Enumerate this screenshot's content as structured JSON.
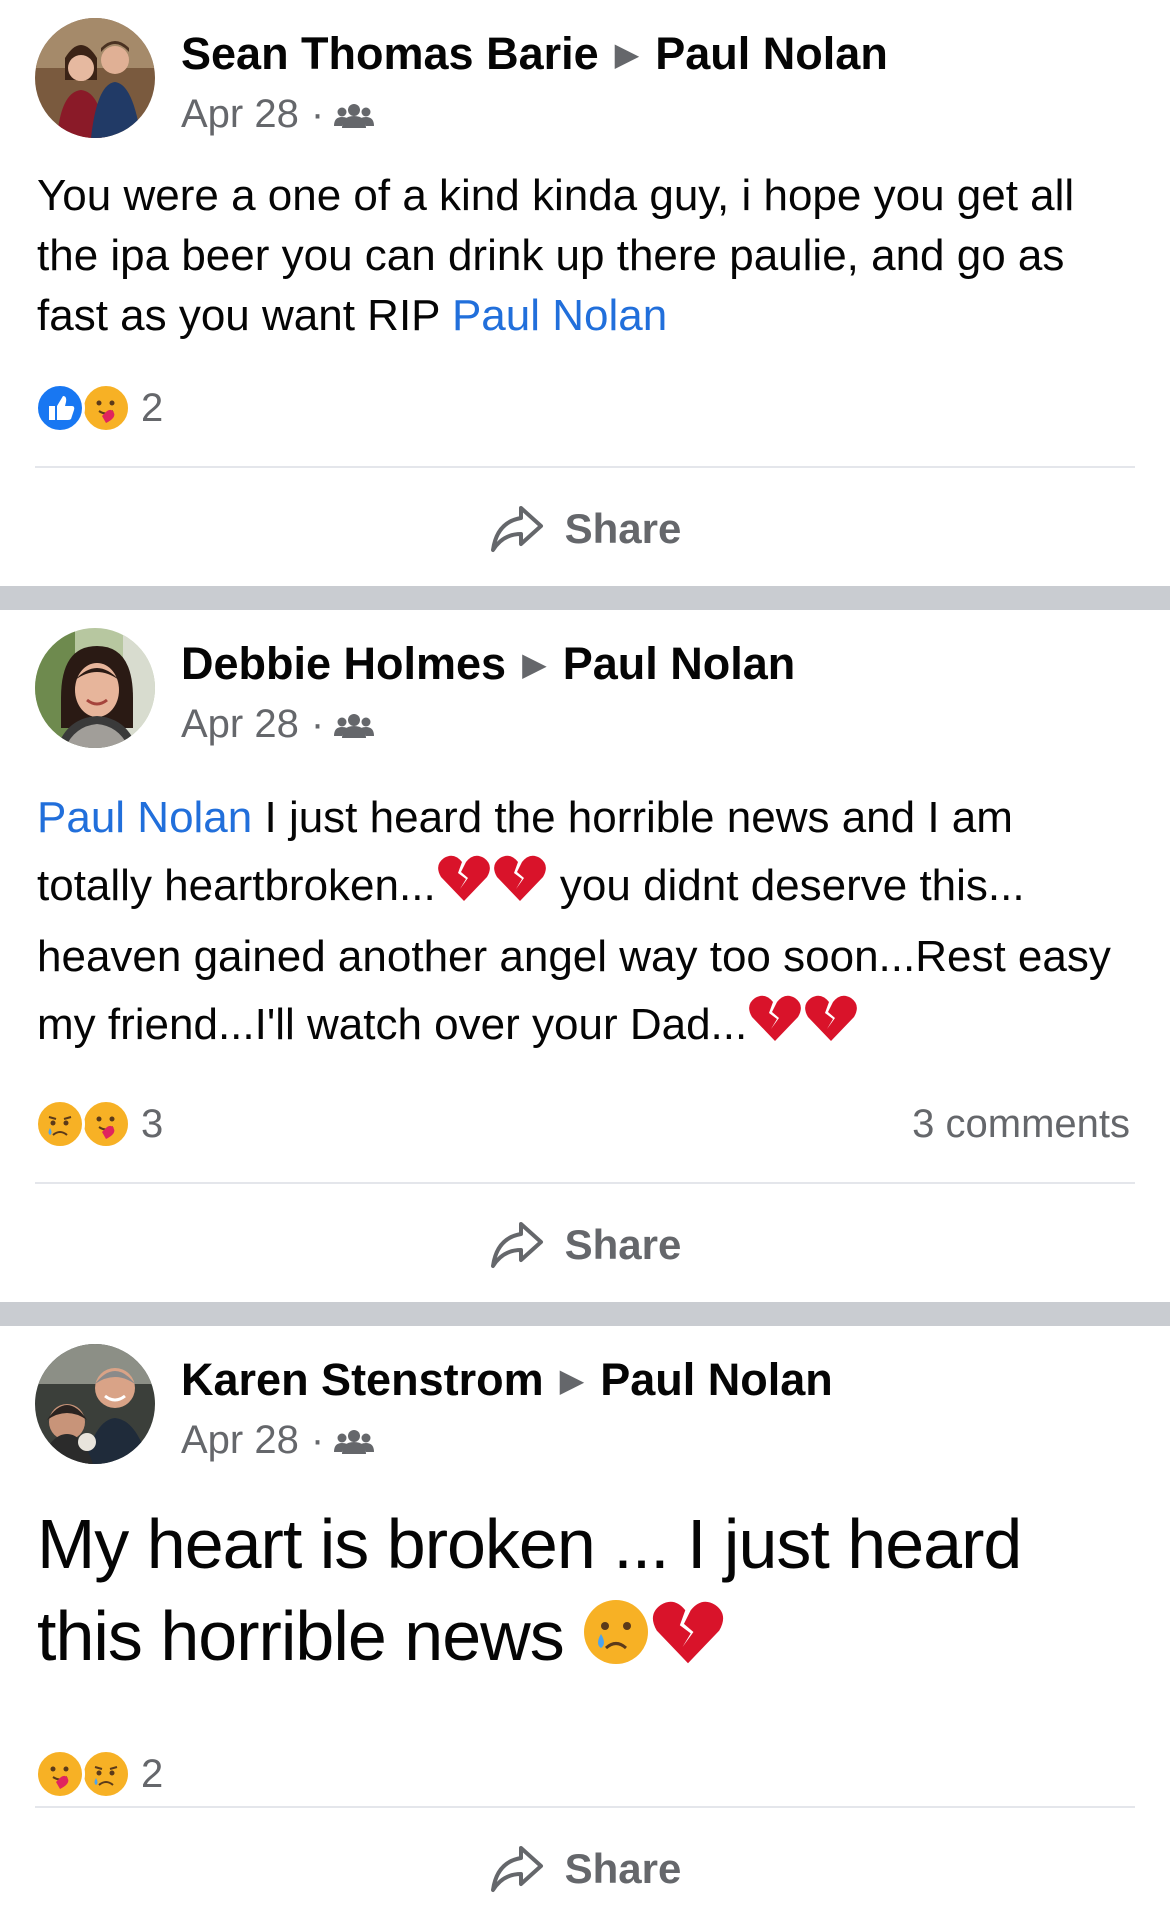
{
  "colors": {
    "mention": "#216fdb",
    "meta": "#65676b",
    "like": "#1877f2",
    "divider": "#c9ccd1"
  },
  "posts": [
    {
      "author": "Sean Thomas Barie",
      "target": "Paul Nolan",
      "date": "Apr 28",
      "text_before": "You were a one of a kind kinda guy, i hope you get all the ipa beer you can drink up there paulie, and go as fast as you want RIP ",
      "mention": "Paul Nolan",
      "reaction_icons": [
        "like-icon",
        "care-icon"
      ],
      "reaction_count": "2",
      "share_label": "Share"
    },
    {
      "author": "Debbie Holmes",
      "target": "Paul Nolan",
      "date": "Apr 28",
      "mention": "Paul Nolan",
      "text_1": " I just heard the horrible news and I am totally heartbroken...",
      "text_2": " you didnt deserve this... heaven gained another angel way too soon...Rest easy my friend...I'll watch over your Dad...",
      "reaction_icons": [
        "sad-icon",
        "care-icon"
      ],
      "reaction_count": "3",
      "comments": "3 comments",
      "share_label": "Share"
    },
    {
      "author": "Karen Stenstrom",
      "target": "Paul Nolan",
      "date": "Apr 28",
      "text": "My heart is broken ... I just heard this horrible news ",
      "reaction_icons": [
        "care-icon",
        "sad-icon"
      ],
      "reaction_count": "2",
      "share_label": "Share"
    }
  ]
}
